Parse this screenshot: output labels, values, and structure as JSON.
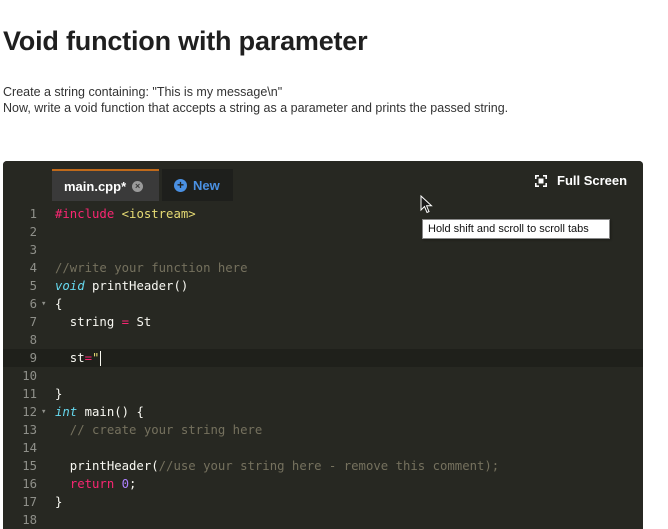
{
  "page": {
    "title": "Void function with parameter",
    "instruction_line1": "Create a string containing: \"This is my message\\n\"",
    "instruction_line2": "Now, write a void function that accepts a string as a parameter and prints the passed string."
  },
  "editor": {
    "tabs": [
      {
        "label": "main.cpp*",
        "active": true,
        "close_icon": "close-icon"
      },
      {
        "label": "New",
        "icon": "plus-circle-icon"
      }
    ],
    "fullscreen_label": "Full Screen",
    "tooltip": "Hold shift and scroll to scroll tabs",
    "colors": {
      "background": "#272822",
      "active_tab": "#3a3a3a",
      "tab_accent": "#c06a1b",
      "new_tab_blue": "#4a90e2"
    },
    "lines": [
      {
        "num": "1",
        "fold": "",
        "highlight": false,
        "tokens": [
          {
            "t": "#include ",
            "c": "kw-pink"
          },
          {
            "t": "<iostream>",
            "c": "str"
          }
        ]
      },
      {
        "num": "2",
        "fold": "",
        "highlight": false,
        "tokens": []
      },
      {
        "num": "3",
        "fold": "",
        "highlight": false,
        "tokens": []
      },
      {
        "num": "4",
        "fold": "",
        "highlight": false,
        "tokens": [
          {
            "t": "//write your function here",
            "c": "cmt"
          }
        ]
      },
      {
        "num": "5",
        "fold": "",
        "highlight": false,
        "tokens": [
          {
            "t": "void",
            "c": "kw-type"
          },
          {
            "t": " printHeader()",
            "c": ""
          }
        ]
      },
      {
        "num": "6",
        "fold": "▾",
        "highlight": false,
        "tokens": [
          {
            "t": "{",
            "c": ""
          }
        ]
      },
      {
        "num": "7",
        "fold": "",
        "highlight": false,
        "tokens": [
          {
            "t": "  string ",
            "c": ""
          },
          {
            "t": "=",
            "c": "kw-pink"
          },
          {
            "t": " St",
            "c": ""
          }
        ]
      },
      {
        "num": "8",
        "fold": "",
        "highlight": false,
        "tokens": []
      },
      {
        "num": "9",
        "fold": "",
        "highlight": true,
        "tokens": [
          {
            "t": "  st",
            "c": ""
          },
          {
            "t": "=",
            "c": "kw-pink"
          },
          {
            "t": "\"",
            "c": "str"
          }
        ],
        "cursor": true
      },
      {
        "num": "10",
        "fold": "",
        "highlight": false,
        "tokens": []
      },
      {
        "num": "11",
        "fold": "",
        "highlight": false,
        "tokens": [
          {
            "t": "}",
            "c": ""
          }
        ]
      },
      {
        "num": "12",
        "fold": "▾",
        "highlight": false,
        "tokens": [
          {
            "t": "int",
            "c": "kw-type"
          },
          {
            "t": " main() {",
            "c": ""
          }
        ]
      },
      {
        "num": "13",
        "fold": "",
        "highlight": false,
        "tokens": [
          {
            "t": "  // create your string here",
            "c": "cmt"
          }
        ]
      },
      {
        "num": "14",
        "fold": "",
        "highlight": false,
        "tokens": []
      },
      {
        "num": "15",
        "fold": "",
        "highlight": false,
        "tokens": [
          {
            "t": "  printHeader(",
            "c": ""
          },
          {
            "t": "//use your string here - remove this comment);",
            "c": "cmt"
          }
        ]
      },
      {
        "num": "16",
        "fold": "",
        "highlight": false,
        "tokens": [
          {
            "t": "  ",
            "c": ""
          },
          {
            "t": "return",
            "c": "kw-pink"
          },
          {
            "t": " ",
            "c": ""
          },
          {
            "t": "0",
            "c": "num"
          },
          {
            "t": ";",
            "c": ""
          }
        ]
      },
      {
        "num": "17",
        "fold": "",
        "highlight": false,
        "tokens": [
          {
            "t": "}",
            "c": ""
          }
        ]
      },
      {
        "num": "18",
        "fold": "",
        "highlight": false,
        "tokens": []
      }
    ]
  }
}
